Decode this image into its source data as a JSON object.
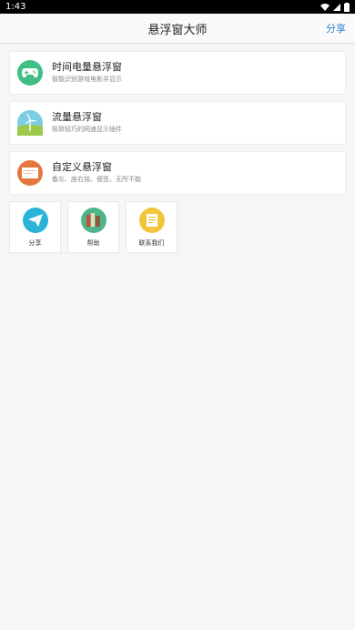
{
  "status": {
    "time": "1:43"
  },
  "appbar": {
    "title": "悬浮窗大师",
    "share_label": "分享"
  },
  "cards": [
    {
      "title": "时间电量悬浮窗",
      "subtitle": "智能识别游戏电影并显示",
      "icon": "gamepad-icon",
      "color": "#3fbf86"
    },
    {
      "title": "流量悬浮窗",
      "subtitle": "极致轻巧的网速显示插件",
      "icon": "windmill-icon",
      "color": "#7ccde3"
    },
    {
      "title": "自定义悬浮窗",
      "subtitle": "备忘、座右铭、便签，无所不能",
      "icon": "window-icon",
      "color": "#e4773d"
    }
  ],
  "tiles": [
    {
      "label": "分享",
      "icon": "paper-plane-icon",
      "color": "#2ab3d6"
    },
    {
      "label": "帮助",
      "icon": "books-icon",
      "color": "#4fb48a"
    },
    {
      "label": "联系我们",
      "icon": "contact-icon",
      "color": "#f2c53a"
    }
  ]
}
